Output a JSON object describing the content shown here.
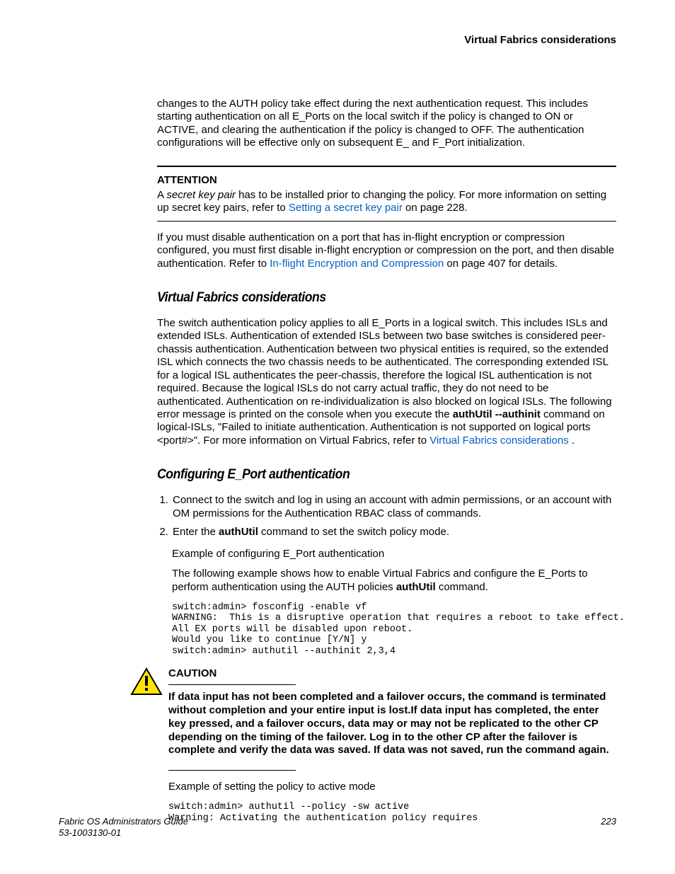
{
  "header": {
    "title": "Virtual Fabrics considerations"
  },
  "intro": {
    "p1": "changes to the AUTH policy take effect during the next authentication request. This includes starting authentication on all E_Ports on the local switch if the policy is changed to ON or ACTIVE, and clearing the authentication if the policy is changed to OFF. The authentication configurations will be effective only on subsequent E_ and F_Port initialization."
  },
  "attention": {
    "title": "ATTENTION",
    "prefix": "A ",
    "italic": "secret key pair",
    "rest1": " has to be installed prior to changing the policy. For more information on setting up secret key pairs, refer to ",
    "link": "Setting a secret key pair",
    "suffix": " on page 228."
  },
  "para2": {
    "text": "If you must disable authentication on a port that has in-flight encryption or compression configured, you must first disable in-flight encryption or compression on the port, and then disable authentication. Refer to ",
    "link": "In-flight Encryption and Compression",
    "suffix": " on page 407 for details."
  },
  "sec1": {
    "heading": "Virtual Fabrics considerations",
    "p_pre": "The switch authentication policy applies to all E_Ports in a logical switch. This includes ISLs and extended ISLs. Authentication of extended ISLs between two base switches is considered peer-chassis authentication. Authentication between two physical entities is required, so the extended ISL which connects the two chassis needs to be authenticated. The corresponding extended ISL for a logical ISL authenticates the peer-chassis, therefore the logical ISL authentication is not required. Because the logical ISLs do not carry actual traffic, they do not need to be authenticated. Authentication on re-individualization is also blocked on logical ISLs. The following error message is printed on the console when you execute the ",
    "cmd": "authUtil --authinit",
    "p_mid": " command on logical-ISLs, \"Failed to initiate authentication. Authentication is not supported on logical ports <port#>\". For more information on Virtual Fabrics, refer to ",
    "link": "Virtual Fabrics considerations",
    "suffix": " ."
  },
  "sec2": {
    "heading": "Configuring E_Port authentication",
    "li1": "Connect to the switch and log in using an account with admin permissions, or an account with OM permissions for the Authentication RBAC class of commands.",
    "li2_pre": "Enter the ",
    "li2_cmd": "authUtil",
    "li2_post": " command to set the switch policy mode.",
    "sub1": "Example of configuring E_Port authentication",
    "sub2_pre": "The following example shows how to enable Virtual Fabrics and configure the E_Ports to perform authentication using the AUTH policies ",
    "sub2_cmd": "authUtil",
    "sub2_post": " command.",
    "code1": "switch:admin> fosconfig -enable vf\nWARNING:  This is a disruptive operation that requires a reboot to take effect.\nAll EX ports will be disabled upon reboot.\nWould you like to continue [Y/N] y\nswitch:admin> authutil --authinit 2,3,4",
    "caution_title": "CAUTION",
    "caution_body": "If data input has not been completed and a failover occurs, the command is terminated without completion and your entire input is lost.If data input has completed, the enter key pressed, and a failover occurs, data may or may not be replicated to the other CP depending on the timing of the failover. Log in to the other CP after the failover is complete and verify the data was saved. If data was not saved, run the command again.",
    "sub3": "Example of setting the policy to active mode",
    "code2": "switch:admin> authutil --policy -sw active\nWarning: Activating the authentication policy requires"
  },
  "footer": {
    "book": "Fabric OS Administrators Guide",
    "docnum": "53-1003130-01",
    "pagenum": "223"
  }
}
